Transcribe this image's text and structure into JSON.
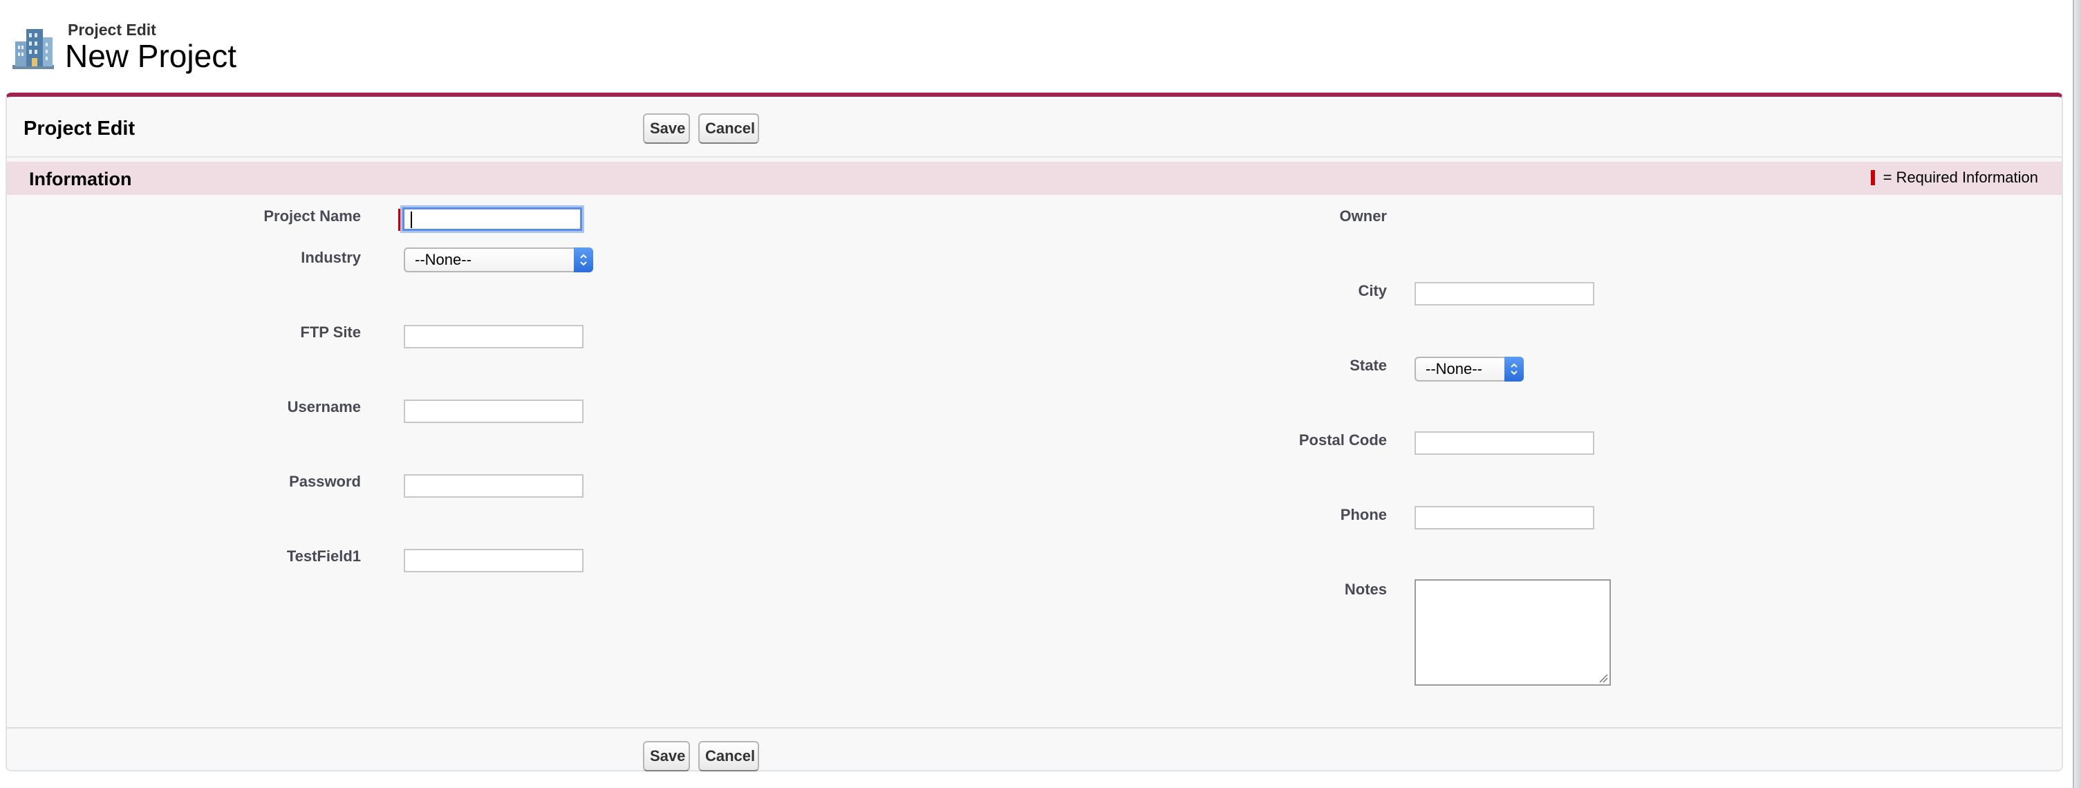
{
  "header": {
    "subtitle": "Project Edit",
    "title": "New Project",
    "icon": "building-icon"
  },
  "panel": {
    "title": "Project Edit",
    "save_label": "Save",
    "cancel_label": "Cancel"
  },
  "section": {
    "title": "Information",
    "required_legend": "= Required Information"
  },
  "left_fields": {
    "project_name": {
      "label": "Project Name",
      "value": "",
      "required": true
    },
    "industry": {
      "label": "Industry",
      "selected": "--None--"
    },
    "ftp_site": {
      "label": "FTP Site",
      "value": ""
    },
    "username": {
      "label": "Username",
      "value": ""
    },
    "password": {
      "label": "Password",
      "value": ""
    },
    "testfield1": {
      "label": "TestField1",
      "value": ""
    }
  },
  "right_fields": {
    "owner": {
      "label": "Owner",
      "value": ""
    },
    "city": {
      "label": "City",
      "value": ""
    },
    "state": {
      "label": "State",
      "selected": "--None--"
    },
    "postal_code": {
      "label": "Postal Code",
      "value": ""
    },
    "phone": {
      "label": "Phone",
      "value": ""
    },
    "notes": {
      "label": "Notes",
      "value": ""
    }
  },
  "colors": {
    "accent": "#a2224f",
    "section_bg": "#f0dde4",
    "required": "#cc0000",
    "focus": "#5b8ee6",
    "select_arrow": "#2a6ddc"
  }
}
